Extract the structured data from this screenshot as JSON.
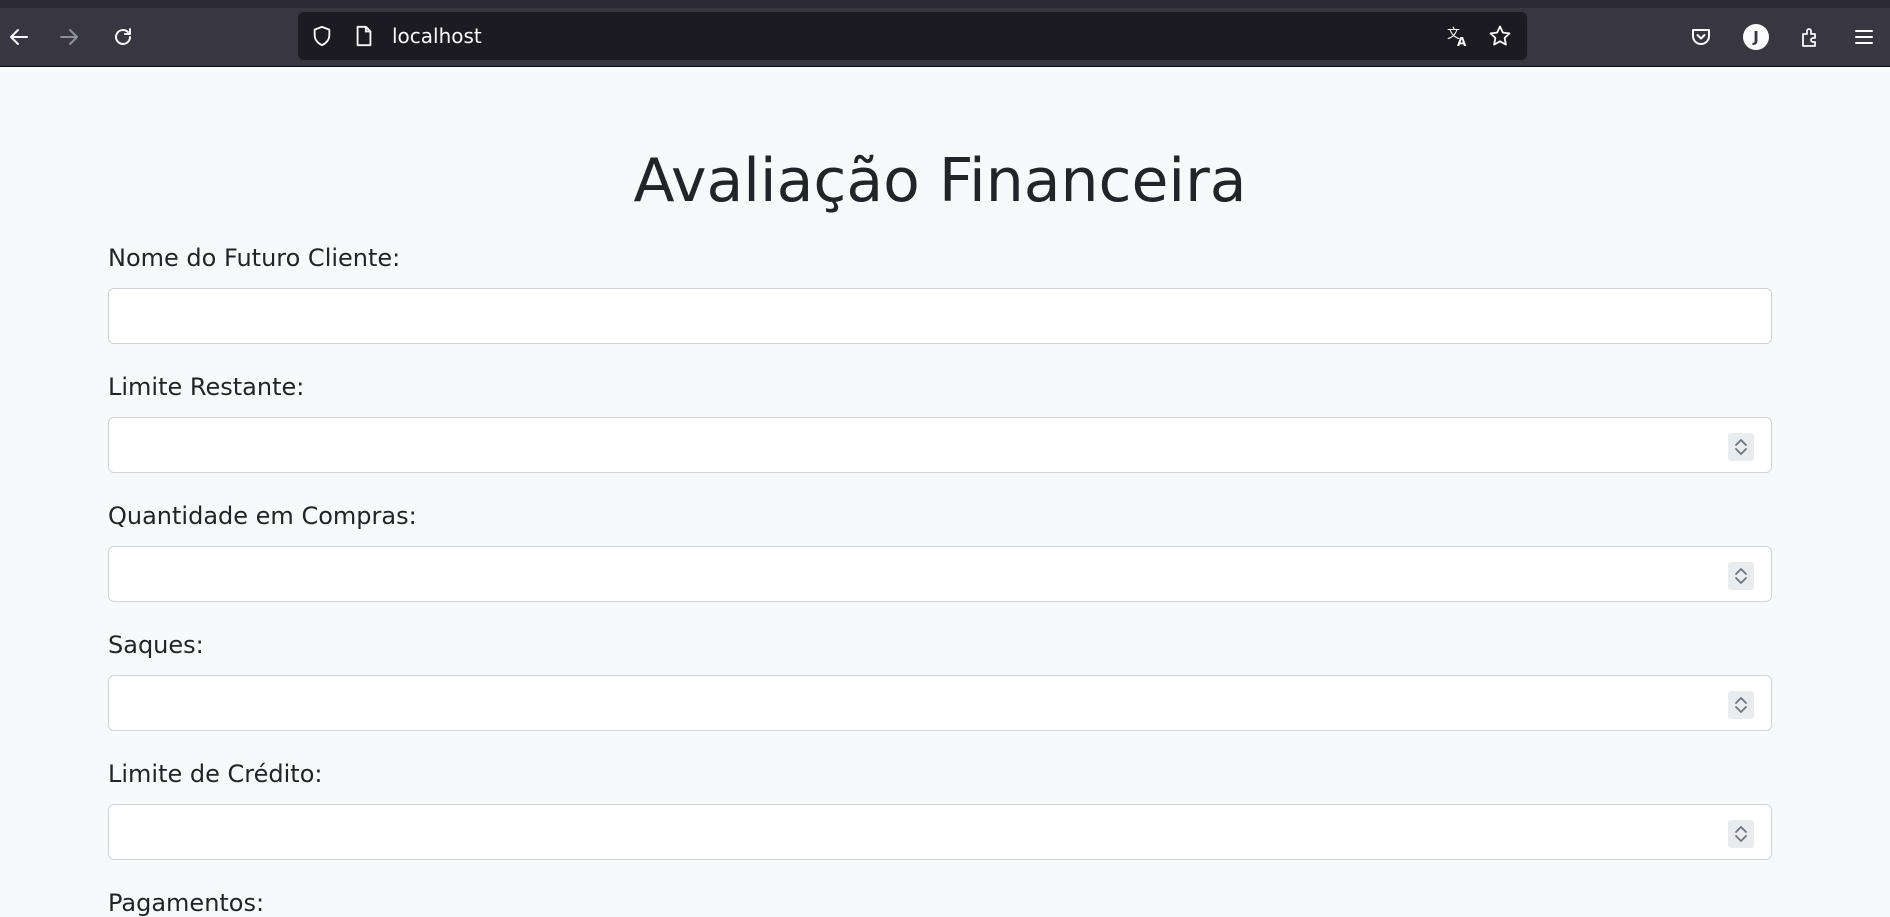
{
  "browser": {
    "url": "localhost",
    "profile_initial": "J",
    "icons": {
      "back": "back-arrow-icon",
      "forward": "forward-arrow-icon",
      "reload": "reload-icon",
      "shield": "shield-icon",
      "page": "page-icon",
      "translate": "translate-icon",
      "bookmark": "star-icon",
      "pocket": "pocket-icon",
      "extensions": "extensions-icon",
      "menu": "hamburger-menu-icon"
    }
  },
  "page": {
    "title": "Avaliação Financeira",
    "fields": [
      {
        "label": "Nome do Futuro Cliente:",
        "value": "",
        "type": "text"
      },
      {
        "label": "Limite Restante:",
        "value": "",
        "type": "number"
      },
      {
        "label": "Quantidade em Compras:",
        "value": "",
        "type": "number"
      },
      {
        "label": "Saques:",
        "value": "",
        "type": "number"
      },
      {
        "label": "Limite de Crédito:",
        "value": "",
        "type": "number"
      },
      {
        "label": "Pagamentos:",
        "value": "",
        "type": "number"
      }
    ]
  },
  "colors": {
    "page_bg": "#f8f9fa",
    "text": "#212529",
    "input_border": "#ced4da",
    "chrome_bg": "#38373f",
    "urlbar_bg": "#1c1b22"
  }
}
